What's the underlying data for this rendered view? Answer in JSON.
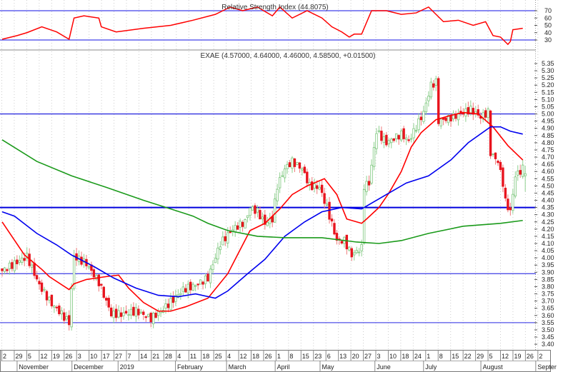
{
  "chart_data": [
    {
      "type": "line",
      "title": "Relative Strength Index (44.8075)",
      "ylim": [
        10,
        85
      ],
      "yticks": [
        "70",
        "60",
        "50",
        "40",
        "30"
      ],
      "bands": [
        70,
        30
      ],
      "series": [
        {
          "name": "RSI",
          "color": "#ff0000",
          "points": [
            [
              0,
              31
            ],
            [
              6,
              36
            ],
            [
              10,
              40
            ],
            [
              16,
              48
            ],
            [
              22,
              41
            ],
            [
              27,
              31
            ],
            [
              29,
              60
            ],
            [
              33,
              63
            ],
            [
              39,
              60
            ],
            [
              40,
              48
            ],
            [
              46,
              41
            ],
            [
              57,
              46
            ],
            [
              68,
              50
            ],
            [
              77,
              57
            ],
            [
              86,
              65
            ],
            [
              92,
              75
            ],
            [
              97,
              70
            ],
            [
              103,
              75
            ],
            [
              109,
              63
            ],
            [
              112,
              75
            ],
            [
              117,
              60
            ],
            [
              123,
              70
            ],
            [
              129,
              60
            ],
            [
              133,
              48
            ],
            [
              137,
              41
            ],
            [
              140,
              34
            ],
            [
              142,
              38
            ],
            [
              145,
              38
            ],
            [
              149,
              70
            ],
            [
              155,
              70
            ],
            [
              161,
              65
            ],
            [
              167,
              67
            ],
            [
              172,
              75
            ],
            [
              178,
              55
            ],
            [
              184,
              57
            ],
            [
              190,
              50
            ],
            [
              195,
              55
            ],
            [
              198,
              36
            ],
            [
              201,
              34
            ],
            [
              204,
              24
            ],
            [
              205,
              28
            ],
            [
              206,
              44
            ],
            [
              210,
              46
            ]
          ]
        }
      ]
    },
    {
      "type": "candlestick",
      "title": "EXAE (4.57000, 4.64000, 4.46000, 4.58500, +0.01500)",
      "ylim": [
        3.4,
        5.35
      ],
      "yticks": [
        "5.35",
        "5.30",
        "5.25",
        "5.20",
        "5.15",
        "5.10",
        "5.05",
        "5.00",
        "4.95",
        "4.90",
        "4.85",
        "4.80",
        "4.75",
        "4.70",
        "4.65",
        "4.60",
        "4.55",
        "4.50",
        "4.45",
        "4.40",
        "4.35",
        "4.30",
        "4.25",
        "4.20",
        "4.15",
        "4.10",
        "4.05",
        "4.00",
        "3.95",
        "3.90",
        "3.85",
        "3.80",
        "3.75",
        "3.70",
        "3.65",
        "3.60",
        "3.55",
        "3.50",
        "3.45",
        "3.40"
      ],
      "last_bar": {
        "open": 4.57,
        "high": 4.64,
        "low": 4.46,
        "close": 4.585,
        "change": 0.015
      },
      "up_color": "#5cb85c",
      "down_color": "#e8141e",
      "horizontal_lines": [
        {
          "value": 5.0,
          "color": "#3030e0"
        },
        {
          "value": 4.35,
          "color": "#0000dd"
        },
        {
          "value": 3.89,
          "color": "#5050e8"
        },
        {
          "value": 3.55,
          "color": "#5050e8"
        }
      ],
      "close_path": [
        [
          0,
          3.91
        ],
        [
          5,
          3.96
        ],
        [
          10,
          4.01
        ],
        [
          15,
          3.81
        ],
        [
          20,
          3.68
        ],
        [
          24,
          3.61
        ],
        [
          27,
          3.55
        ],
        [
          29,
          4.01
        ],
        [
          34,
          3.96
        ],
        [
          39,
          3.83
        ],
        [
          44,
          3.61
        ],
        [
          49,
          3.61
        ],
        [
          54,
          3.63
        ],
        [
          60,
          3.58
        ],
        [
          64,
          3.63
        ],
        [
          69,
          3.71
        ],
        [
          73,
          3.78
        ],
        [
          78,
          3.81
        ],
        [
          83,
          3.86
        ],
        [
          88,
          4.1
        ],
        [
          93,
          4.2
        ],
        [
          98,
          4.25
        ],
        [
          100,
          4.35
        ],
        [
          103,
          4.32
        ],
        [
          106,
          4.24
        ],
        [
          109,
          4.27
        ],
        [
          111,
          4.5
        ],
        [
          114,
          4.62
        ],
        [
          117,
          4.67
        ],
        [
          121,
          4.62
        ],
        [
          124,
          4.5
        ],
        [
          128,
          4.49
        ],
        [
          131,
          4.35
        ],
        [
          135,
          4.12
        ],
        [
          138,
          4.12
        ],
        [
          141,
          4.02
        ],
        [
          145,
          4.07
        ],
        [
          146,
          4.5
        ],
        [
          148,
          4.52
        ],
        [
          151,
          4.88
        ],
        [
          155,
          4.8
        ],
        [
          161,
          4.86
        ],
        [
          164,
          4.81
        ],
        [
          167,
          4.91
        ],
        [
          170,
          5.01
        ],
        [
          173,
          5.2
        ],
        [
          175,
          5.22
        ],
        [
          176,
          4.95
        ],
        [
          182,
          4.98
        ],
        [
          186,
          5.01
        ],
        [
          189,
          5.03
        ],
        [
          193,
          4.98
        ],
        [
          196,
          5.01
        ],
        [
          197,
          4.73
        ],
        [
          200,
          4.67
        ],
        [
          202,
          4.52
        ],
        [
          203,
          4.39
        ],
        [
          205,
          4.32
        ],
        [
          207,
          4.57
        ],
        [
          210,
          4.62
        ],
        [
          211,
          4.585
        ]
      ],
      "moving_averages": [
        {
          "name": "MA short",
          "color": "#ff0000",
          "points": [
            [
              0,
              4.25
            ],
            [
              9,
              4.02
            ],
            [
              16,
              3.92
            ],
            [
              19,
              3.87
            ],
            [
              27,
              3.78
            ],
            [
              29,
              3.82
            ],
            [
              34,
              3.85
            ],
            [
              42,
              3.87
            ],
            [
              47,
              3.88
            ],
            [
              51,
              3.79
            ],
            [
              57,
              3.69
            ],
            [
              63,
              3.63
            ],
            [
              68,
              3.63
            ],
            [
              74,
              3.66
            ],
            [
              83,
              3.72
            ],
            [
              91,
              3.89
            ],
            [
              100,
              4.19
            ],
            [
              106,
              4.24
            ],
            [
              112,
              4.34
            ],
            [
              117,
              4.44
            ],
            [
              123,
              4.5
            ],
            [
              130,
              4.55
            ],
            [
              135,
              4.44
            ],
            [
              139,
              4.27
            ],
            [
              145,
              4.24
            ],
            [
              147,
              4.27
            ],
            [
              152,
              4.35
            ],
            [
              156,
              4.45
            ],
            [
              161,
              4.6
            ],
            [
              165,
              4.77
            ],
            [
              169,
              4.87
            ],
            [
              175,
              4.96
            ],
            [
              181,
              4.99
            ],
            [
              186,
              5.01
            ],
            [
              192,
              5.0
            ],
            [
              198,
              4.91
            ],
            [
              204,
              4.78
            ],
            [
              210,
              4.68
            ]
          ]
        },
        {
          "name": "MA medium",
          "color": "#0000ee",
          "points": [
            [
              0,
              4.32
            ],
            [
              5,
              4.29
            ],
            [
              14,
              4.17
            ],
            [
              22,
              4.09
            ],
            [
              28,
              4.02
            ],
            [
              37,
              3.94
            ],
            [
              45,
              3.86
            ],
            [
              54,
              3.79
            ],
            [
              63,
              3.74
            ],
            [
              71,
              3.73
            ],
            [
              78,
              3.75
            ],
            [
              86,
              3.72
            ],
            [
              91,
              3.77
            ],
            [
              99,
              3.89
            ],
            [
              106,
              3.99
            ],
            [
              114,
              4.15
            ],
            [
              122,
              4.25
            ],
            [
              129,
              4.32
            ],
            [
              137,
              4.35
            ],
            [
              145,
              4.34
            ],
            [
              155,
              4.44
            ],
            [
              163,
              4.52
            ],
            [
              172,
              4.57
            ],
            [
              181,
              4.68
            ],
            [
              188,
              4.8
            ],
            [
              197,
              4.91
            ],
            [
              201,
              4.91
            ],
            [
              205,
              4.88
            ],
            [
              210,
              4.86
            ]
          ]
        },
        {
          "name": "MA long",
          "color": "#1a9a1a",
          "points": [
            [
              0,
              4.82
            ],
            [
              14,
              4.67
            ],
            [
              28,
              4.57
            ],
            [
              42,
              4.49
            ],
            [
              57,
              4.4
            ],
            [
              68,
              4.34
            ],
            [
              77,
              4.29
            ],
            [
              83,
              4.24
            ],
            [
              91,
              4.19
            ],
            [
              103,
              4.15
            ],
            [
              114,
              4.14
            ],
            [
              129,
              4.14
            ],
            [
              143,
              4.11
            ],
            [
              152,
              4.1
            ],
            [
              161,
              4.12
            ],
            [
              172,
              4.17
            ],
            [
              186,
              4.22
            ],
            [
              201,
              4.24
            ],
            [
              210,
              4.26
            ]
          ]
        }
      ]
    }
  ],
  "x_axis": {
    "week_labels": [
      "2",
      "29",
      "5",
      "12",
      "19",
      "26",
      "3",
      "10",
      "17",
      "27",
      "7",
      "14",
      "21",
      "28",
      "4",
      "11",
      "18",
      "25",
      "4",
      "12",
      "18",
      "26",
      "1",
      "8",
      "15",
      "23",
      "6",
      "13",
      "20",
      "27",
      "3",
      "10",
      "18",
      "24",
      "1",
      "8",
      "15",
      "22",
      "29",
      "5",
      "12",
      "19",
      "26",
      "2"
    ],
    "months": [
      {
        "label": "November",
        "week": 1.4
      },
      {
        "label": "December",
        "week": 5.8
      },
      {
        "label": "2019",
        "week": 9.5
      },
      {
        "label": "February",
        "week": 14.1
      },
      {
        "label": "March",
        "week": 18.2
      },
      {
        "label": "April",
        "week": 22.1
      },
      {
        "label": "May",
        "week": 25.7
      },
      {
        "label": "June",
        "week": 30.1
      },
      {
        "label": "July",
        "week": 34
      },
      {
        "label": "August",
        "week": 38.6
      },
      {
        "label": "Septer",
        "week": 43
      }
    ]
  }
}
